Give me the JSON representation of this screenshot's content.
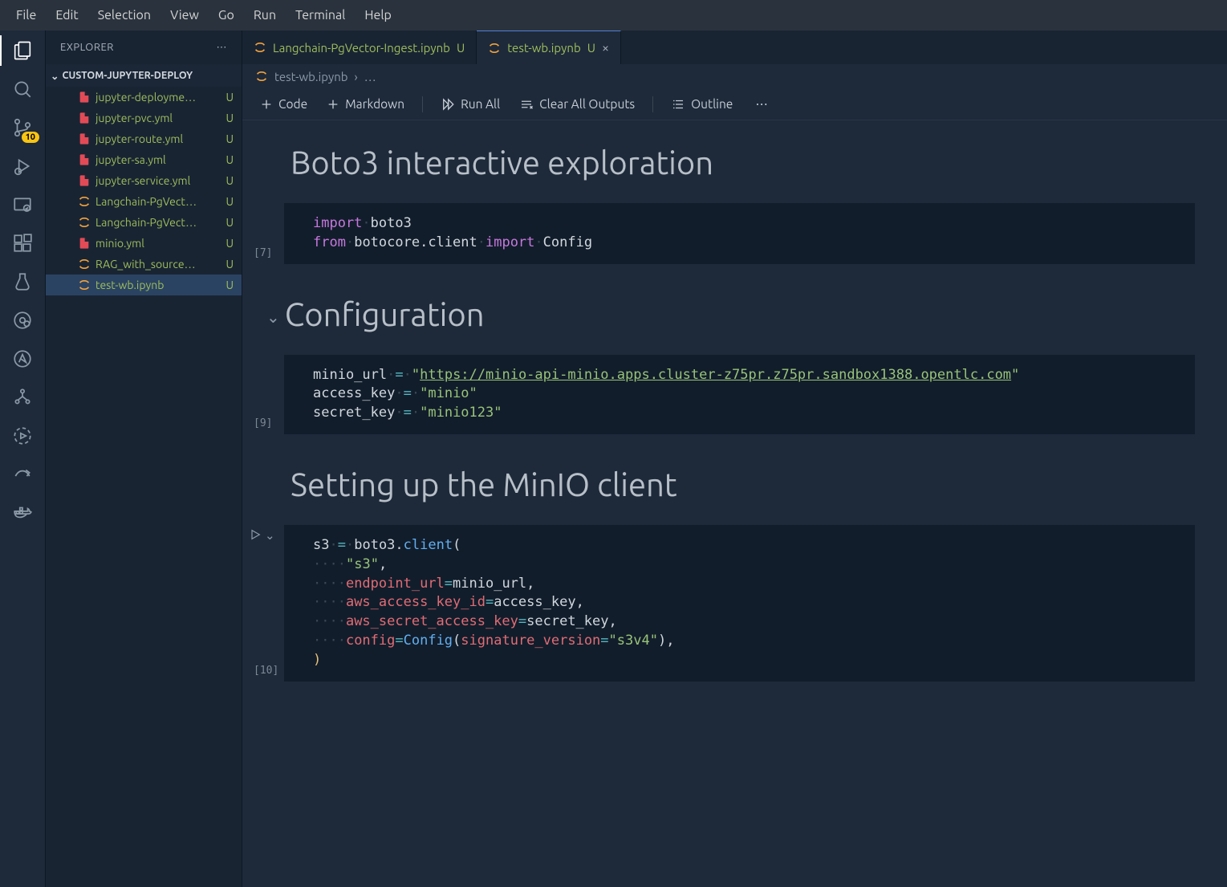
{
  "menubar": [
    "File",
    "Edit",
    "Selection",
    "View",
    "Go",
    "Run",
    "Terminal",
    "Help"
  ],
  "activity": {
    "badge": "10"
  },
  "sidebar": {
    "title": "EXPLORER",
    "section": "CUSTOM-JUPYTER-DEPLOY",
    "files": [
      {
        "name": "jupyter-deployme…",
        "type": "yaml",
        "status": "U",
        "selected": false
      },
      {
        "name": "jupyter-pvc.yml",
        "type": "yaml",
        "status": "U",
        "selected": false
      },
      {
        "name": "jupyter-route.yml",
        "type": "yaml",
        "status": "U",
        "selected": false
      },
      {
        "name": "jupyter-sa.yml",
        "type": "yaml",
        "status": "U",
        "selected": false
      },
      {
        "name": "jupyter-service.yml",
        "type": "yaml",
        "status": "U",
        "selected": false
      },
      {
        "name": "Langchain-PgVect…",
        "type": "nb",
        "status": "U",
        "selected": false
      },
      {
        "name": "Langchain-PgVect…",
        "type": "nb",
        "status": "U",
        "selected": false
      },
      {
        "name": "minio.yml",
        "type": "yaml",
        "status": "U",
        "selected": false
      },
      {
        "name": "RAG_with_source…",
        "type": "nb",
        "status": "U",
        "selected": false
      },
      {
        "name": "test-wb.ipynb",
        "type": "nb",
        "status": "U",
        "selected": true
      }
    ]
  },
  "tabs": [
    {
      "label": "Langchain-PgVector-Ingest.ipynb",
      "status": "U",
      "active": false,
      "close": false
    },
    {
      "label": "test-wb.ipynb",
      "status": "U",
      "active": true,
      "close": true
    }
  ],
  "breadcrumb": {
    "file": "test-wb.ipynb",
    "sep": "›",
    "more": "…"
  },
  "toolbar": {
    "code": "Code",
    "markdown": "Markdown",
    "runall": "Run All",
    "clear": "Clear All Outputs",
    "outline": "Outline"
  },
  "notebook": {
    "h1_1": "Boto3 interactive exploration",
    "exec1": "[7]",
    "h1_2": "Configuration",
    "exec2": "[9]",
    "h1_3": "Setting up the MinIO client",
    "exec3": "[10]",
    "code1": {
      "import": "import",
      "sp": "·",
      "boto3": "boto3",
      "from": "from",
      "botocore": "botocore.client",
      "config": "Config"
    },
    "code2": {
      "minio_url": "minio_url",
      "eq": "=",
      "dot": "·",
      "q": "\"",
      "url": "https://minio-api-minio.apps.cluster-z75pr.z75pr.sandbox1388.opentlc.com",
      "access_key": "access_key",
      "minio": "minio",
      "secret_key": "secret_key",
      "minio123": "minio123"
    },
    "code3": {
      "s3": "s3",
      "eq": "=",
      "dot": "·",
      "boto3": "boto3",
      "client": "client",
      "lp": "(",
      "s3str": "s3",
      "comma": ",",
      "endpoint_url": "endpoint_url",
      "minio_url": "minio_url",
      "aws_access_key_id": "aws_access_key_id",
      "access_key": "access_key",
      "aws_secret_access_key": "aws_secret_access_key",
      "secret_key": "secret_key",
      "config": "config",
      "Config": "Config",
      "sig": "signature_version",
      "s3v4": "s3v4",
      "rp": ")",
      "ws4": "····"
    }
  }
}
